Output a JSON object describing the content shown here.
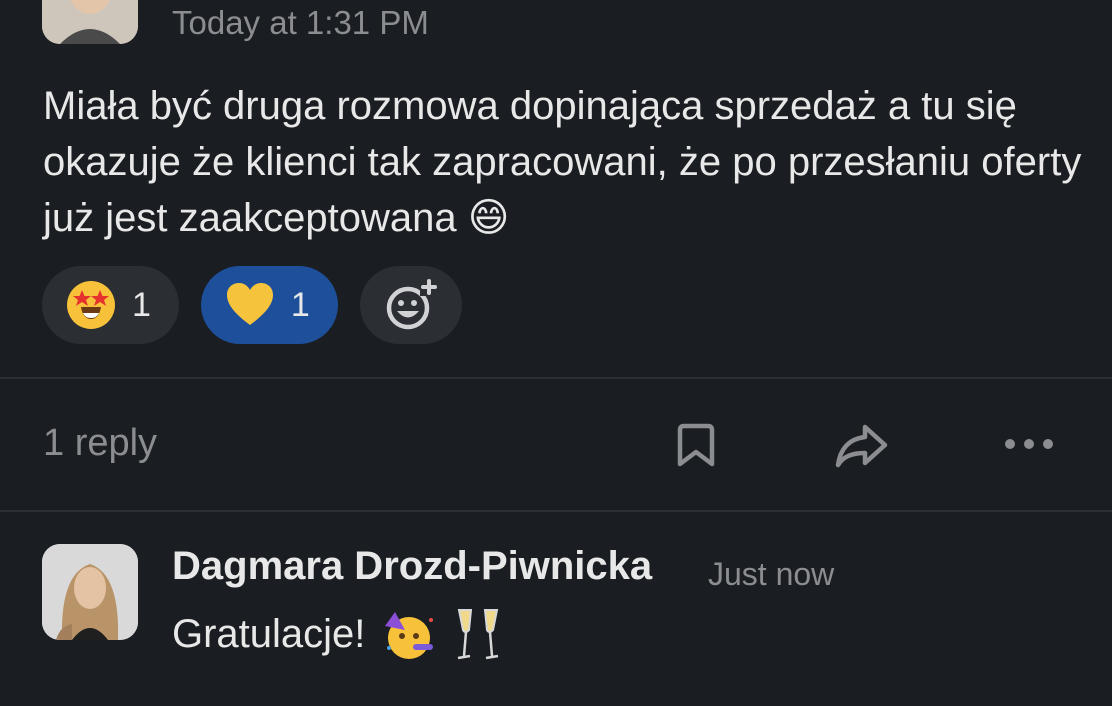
{
  "message": {
    "timestamp": "Today at 1:31 PM",
    "body": "Miała być druga rozmowa dopinająca sprzedaż a tu się okazuje że klienci tak zapracowani, że po przesłaniu oferty już jest zaakceptowana",
    "body_emoji": "😄",
    "reactions": [
      {
        "emoji": "star-struck-icon",
        "count": "1",
        "selected": false
      },
      {
        "emoji": "yellow-heart-icon",
        "count": "1",
        "selected": true
      }
    ],
    "add_reaction_icon": "add-reaction-icon"
  },
  "thread": {
    "reply_count": "1 reply",
    "actions": [
      "bookmark-icon",
      "share-icon",
      "more-icon"
    ]
  },
  "reply": {
    "author": "Dagmara Drozd-Piwnicka",
    "time": "Just now",
    "text": "Gratulacje!",
    "emojis": [
      "partying-face-icon",
      "champagne-glasses-icon"
    ]
  },
  "colors": {
    "background": "#1a1d21",
    "selected_reaction": "#1d4f9a",
    "reaction_pill": "#2b2e33",
    "muted_text": "#8b8d90",
    "text": "#e8e8e8"
  }
}
